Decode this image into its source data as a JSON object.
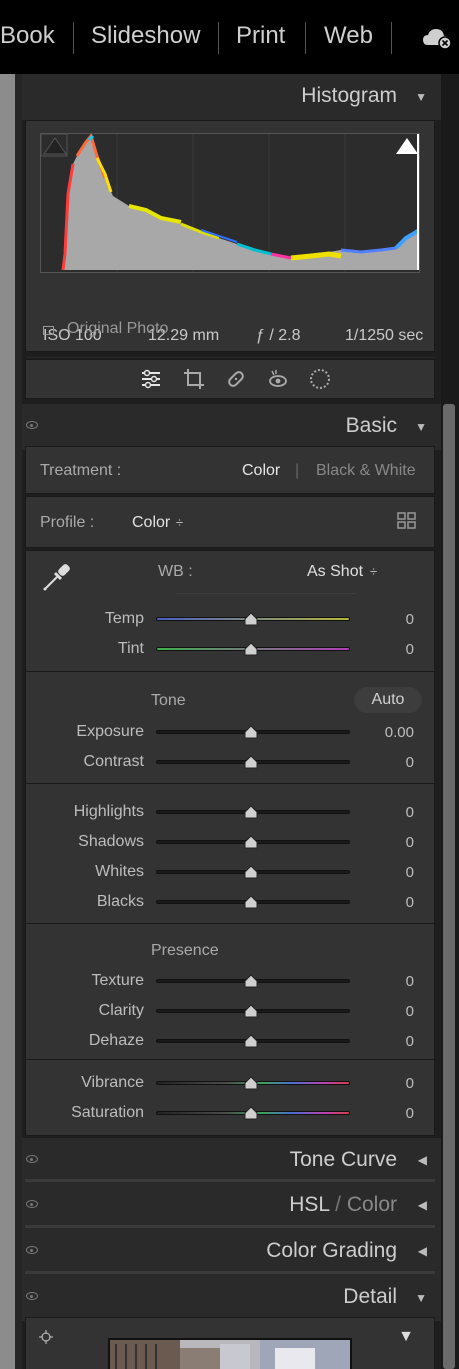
{
  "modules": [
    "Book",
    "Slideshow",
    "Print",
    "Web"
  ],
  "histogram": {
    "title": "Histogram",
    "iso": "ISO 100",
    "focal": "12.29 mm",
    "aperture": "ƒ / 2.8",
    "shutter": "1/1250 sec",
    "original_photo": "Original Photo"
  },
  "tools": [
    "sliders-icon",
    "crop-icon",
    "healing-icon",
    "red-eye-icon",
    "mask-icon"
  ],
  "basic": {
    "title": "Basic",
    "treatment_label": "Treatment :",
    "treatment_color": "Color",
    "treatment_divider": "|",
    "treatment_bw": "Black & White",
    "profile_label": "Profile :",
    "profile_value": "Color",
    "profile_caret": "÷",
    "wb_label": "WB :",
    "wb_value": "As Shot",
    "wb_caret": "÷",
    "tone_label": "Tone",
    "auto_label": "Auto",
    "presence_label": "Presence",
    "sliders": [
      {
        "label": "Temp",
        "value": "0"
      },
      {
        "label": "Tint",
        "value": "0"
      },
      {
        "label": "Exposure",
        "value": "0.00"
      },
      {
        "label": "Contrast",
        "value": "0"
      },
      {
        "label": "Highlights",
        "value": "0"
      },
      {
        "label": "Shadows",
        "value": "0"
      },
      {
        "label": "Whites",
        "value": "0"
      },
      {
        "label": "Blacks",
        "value": "0"
      },
      {
        "label": "Texture",
        "value": "0"
      },
      {
        "label": "Clarity",
        "value": "0"
      },
      {
        "label": "Dehaze",
        "value": "0"
      },
      {
        "label": "Vibrance",
        "value": "0"
      },
      {
        "label": "Saturation",
        "value": "0"
      }
    ]
  },
  "panels": {
    "tone_curve": "Tone Curve",
    "hsl": "HSL",
    "hsl_sep": "/",
    "hsl_color": "Color",
    "color_grading": "Color Grading",
    "detail": "Detail"
  },
  "colors": {
    "panel_bg": "#1e1e1e",
    "section_bg": "#333333",
    "header_bg": "#2a2a2a",
    "text": "#bdbdbd"
  }
}
